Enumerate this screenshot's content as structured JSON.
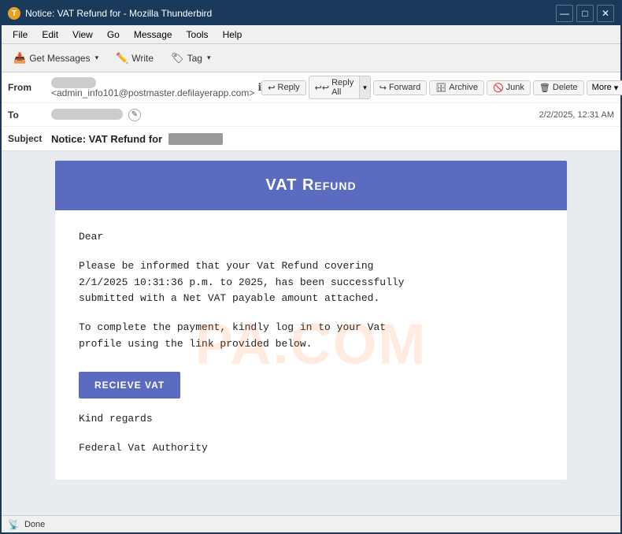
{
  "window": {
    "title": "Notice: VAT Refund for        - Mozilla Thunderbird",
    "title_short": "Notice: VAT Refund for",
    "redacted": "        "
  },
  "titlebar": {
    "app_icon": "T",
    "minimize": "—",
    "maximize": "□",
    "close": "✕"
  },
  "menubar": {
    "items": [
      "File",
      "Edit",
      "View",
      "Go",
      "Message",
      "Tools",
      "Help"
    ]
  },
  "toolbar": {
    "get_messages": "Get Messages",
    "write": "Write",
    "tag": "Tag"
  },
  "email": {
    "from_label": "From",
    "from_name": "[redacted]",
    "from_email": "<admin_info101@postmaster.defilayerapp.com>",
    "to_label": "To",
    "to_name": "[redacted]",
    "subject_label": "Subject",
    "subject_prefix": "Notice: VAT Refund for",
    "subject_redacted": "       ",
    "timestamp": "2/2/2025, 12:31 AM",
    "actions": {
      "reply": "Reply",
      "reply_all": "Reply All",
      "forward": "Forward",
      "archive": "Archive",
      "junk": "Junk",
      "delete": "Delete",
      "more": "More"
    }
  },
  "email_body": {
    "header": "VAT Refund",
    "greeting": "Dear",
    "paragraph1": "Please be informed that your Vat Refund covering\n2/1/2025 10:31:36 p.m. to 2025, has been successfully\nsubmitted with a Net VAT payable amount attached.",
    "paragraph2": "To complete the payment, kindly log in to your Vat\nprofile using the link provided below.",
    "button": "RECIEVE VAT",
    "closing": "Kind regards",
    "signature": "Federal Vat Authority"
  },
  "statusbar": {
    "status": "Done"
  },
  "colors": {
    "titlebar_bg": "#1a3a5c",
    "header_bg": "#5b6bbf",
    "button_bg": "#5b6bbf",
    "watermark_color": "#ff7832"
  }
}
